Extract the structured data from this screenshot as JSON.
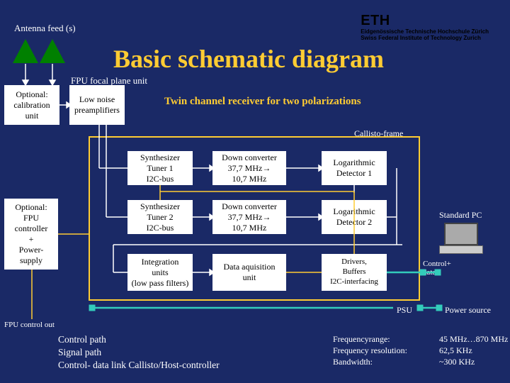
{
  "header": {
    "antenna_label": "Antenna feed (s)",
    "institution_short": "ETH",
    "institution_line1": "Eidgenössische Technische Hochschule Zürich",
    "institution_line2": "Swiss Federal Institute of Technology Zurich",
    "main_title": "Basic schematic diagram",
    "fpu_label": "FPU focal plane unit",
    "subtitle": "Twin channel receiver for two polarizations"
  },
  "boxes": {
    "optional_cal": "Optional:\ncalibration\nunit",
    "preamp": "Low noise\npreamplifiers",
    "callisto_frame_label": "Callisto-frame",
    "synth1": "Synthesizer\nTuner 1\nI2C-bus",
    "down1": "Down converter\n37,7 MHz→\n10,7 MHz",
    "log1": "Logarithmic\nDetector 1",
    "synth2": "Synthesizer\nTuner 2\nI2C-bus",
    "down2": "Down converter\n37,7 MHz→\n10,7 MHz",
    "log2": "Logarithmic\nDetector 2",
    "integration": "Integration\nunits\n(low pass filters)",
    "daq": "Data aquisition\nunit",
    "drivers": "Drivers,\nBuffers\nI2C-interfacing",
    "optional_fpu": "Optional:\nFPU\ncontroller\n+\nPower-\nsupply"
  },
  "right": {
    "std_pc": "Standard PC",
    "control_data": "Control+\ndata",
    "psu": "PSU",
    "power_source": "Power source"
  },
  "footer": {
    "fpu_control_out": "FPU control out",
    "legend_control": "Control path",
    "legend_signal": "Signal path",
    "legend_link": "Control- data link Callisto/Host-controller",
    "spec_label_freq": "Frequencyrange:",
    "spec_label_res": "Frequency resolution:",
    "spec_label_bw": "Bandwidth:",
    "spec_val_freq": "45 MHz…870 MHz",
    "spec_val_res": "62,5 KHz",
    "spec_val_bw": "~300 KHz"
  }
}
